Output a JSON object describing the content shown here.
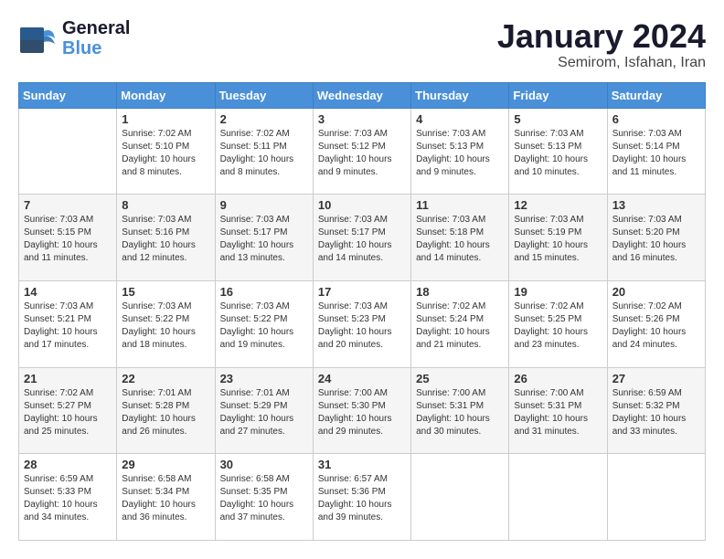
{
  "header": {
    "logo_line1": "General",
    "logo_line2": "Blue",
    "month_title": "January 2024",
    "subtitle": "Semirom, Isfahan, Iran"
  },
  "weekdays": [
    "Sunday",
    "Monday",
    "Tuesday",
    "Wednesday",
    "Thursday",
    "Friday",
    "Saturday"
  ],
  "weeks": [
    [
      {
        "day": "",
        "info": ""
      },
      {
        "day": "1",
        "info": "Sunrise: 7:02 AM\nSunset: 5:10 PM\nDaylight: 10 hours\nand 8 minutes."
      },
      {
        "day": "2",
        "info": "Sunrise: 7:02 AM\nSunset: 5:11 PM\nDaylight: 10 hours\nand 8 minutes."
      },
      {
        "day": "3",
        "info": "Sunrise: 7:03 AM\nSunset: 5:12 PM\nDaylight: 10 hours\nand 9 minutes."
      },
      {
        "day": "4",
        "info": "Sunrise: 7:03 AM\nSunset: 5:13 PM\nDaylight: 10 hours\nand 9 minutes."
      },
      {
        "day": "5",
        "info": "Sunrise: 7:03 AM\nSunset: 5:13 PM\nDaylight: 10 hours\nand 10 minutes."
      },
      {
        "day": "6",
        "info": "Sunrise: 7:03 AM\nSunset: 5:14 PM\nDaylight: 10 hours\nand 11 minutes."
      }
    ],
    [
      {
        "day": "7",
        "info": "Sunrise: 7:03 AM\nSunset: 5:15 PM\nDaylight: 10 hours\nand 11 minutes."
      },
      {
        "day": "8",
        "info": "Sunrise: 7:03 AM\nSunset: 5:16 PM\nDaylight: 10 hours\nand 12 minutes."
      },
      {
        "day": "9",
        "info": "Sunrise: 7:03 AM\nSunset: 5:17 PM\nDaylight: 10 hours\nand 13 minutes."
      },
      {
        "day": "10",
        "info": "Sunrise: 7:03 AM\nSunset: 5:17 PM\nDaylight: 10 hours\nand 14 minutes."
      },
      {
        "day": "11",
        "info": "Sunrise: 7:03 AM\nSunset: 5:18 PM\nDaylight: 10 hours\nand 14 minutes."
      },
      {
        "day": "12",
        "info": "Sunrise: 7:03 AM\nSunset: 5:19 PM\nDaylight: 10 hours\nand 15 minutes."
      },
      {
        "day": "13",
        "info": "Sunrise: 7:03 AM\nSunset: 5:20 PM\nDaylight: 10 hours\nand 16 minutes."
      }
    ],
    [
      {
        "day": "14",
        "info": "Sunrise: 7:03 AM\nSunset: 5:21 PM\nDaylight: 10 hours\nand 17 minutes."
      },
      {
        "day": "15",
        "info": "Sunrise: 7:03 AM\nSunset: 5:22 PM\nDaylight: 10 hours\nand 18 minutes."
      },
      {
        "day": "16",
        "info": "Sunrise: 7:03 AM\nSunset: 5:22 PM\nDaylight: 10 hours\nand 19 minutes."
      },
      {
        "day": "17",
        "info": "Sunrise: 7:03 AM\nSunset: 5:23 PM\nDaylight: 10 hours\nand 20 minutes."
      },
      {
        "day": "18",
        "info": "Sunrise: 7:02 AM\nSunset: 5:24 PM\nDaylight: 10 hours\nand 21 minutes."
      },
      {
        "day": "19",
        "info": "Sunrise: 7:02 AM\nSunset: 5:25 PM\nDaylight: 10 hours\nand 23 minutes."
      },
      {
        "day": "20",
        "info": "Sunrise: 7:02 AM\nSunset: 5:26 PM\nDaylight: 10 hours\nand 24 minutes."
      }
    ],
    [
      {
        "day": "21",
        "info": "Sunrise: 7:02 AM\nSunset: 5:27 PM\nDaylight: 10 hours\nand 25 minutes."
      },
      {
        "day": "22",
        "info": "Sunrise: 7:01 AM\nSunset: 5:28 PM\nDaylight: 10 hours\nand 26 minutes."
      },
      {
        "day": "23",
        "info": "Sunrise: 7:01 AM\nSunset: 5:29 PM\nDaylight: 10 hours\nand 27 minutes."
      },
      {
        "day": "24",
        "info": "Sunrise: 7:00 AM\nSunset: 5:30 PM\nDaylight: 10 hours\nand 29 minutes."
      },
      {
        "day": "25",
        "info": "Sunrise: 7:00 AM\nSunset: 5:31 PM\nDaylight: 10 hours\nand 30 minutes."
      },
      {
        "day": "26",
        "info": "Sunrise: 7:00 AM\nSunset: 5:31 PM\nDaylight: 10 hours\nand 31 minutes."
      },
      {
        "day": "27",
        "info": "Sunrise: 6:59 AM\nSunset: 5:32 PM\nDaylight: 10 hours\nand 33 minutes."
      }
    ],
    [
      {
        "day": "28",
        "info": "Sunrise: 6:59 AM\nSunset: 5:33 PM\nDaylight: 10 hours\nand 34 minutes."
      },
      {
        "day": "29",
        "info": "Sunrise: 6:58 AM\nSunset: 5:34 PM\nDaylight: 10 hours\nand 36 minutes."
      },
      {
        "day": "30",
        "info": "Sunrise: 6:58 AM\nSunset: 5:35 PM\nDaylight: 10 hours\nand 37 minutes."
      },
      {
        "day": "31",
        "info": "Sunrise: 6:57 AM\nSunset: 5:36 PM\nDaylight: 10 hours\nand 39 minutes."
      },
      {
        "day": "",
        "info": ""
      },
      {
        "day": "",
        "info": ""
      },
      {
        "day": "",
        "info": ""
      }
    ]
  ]
}
